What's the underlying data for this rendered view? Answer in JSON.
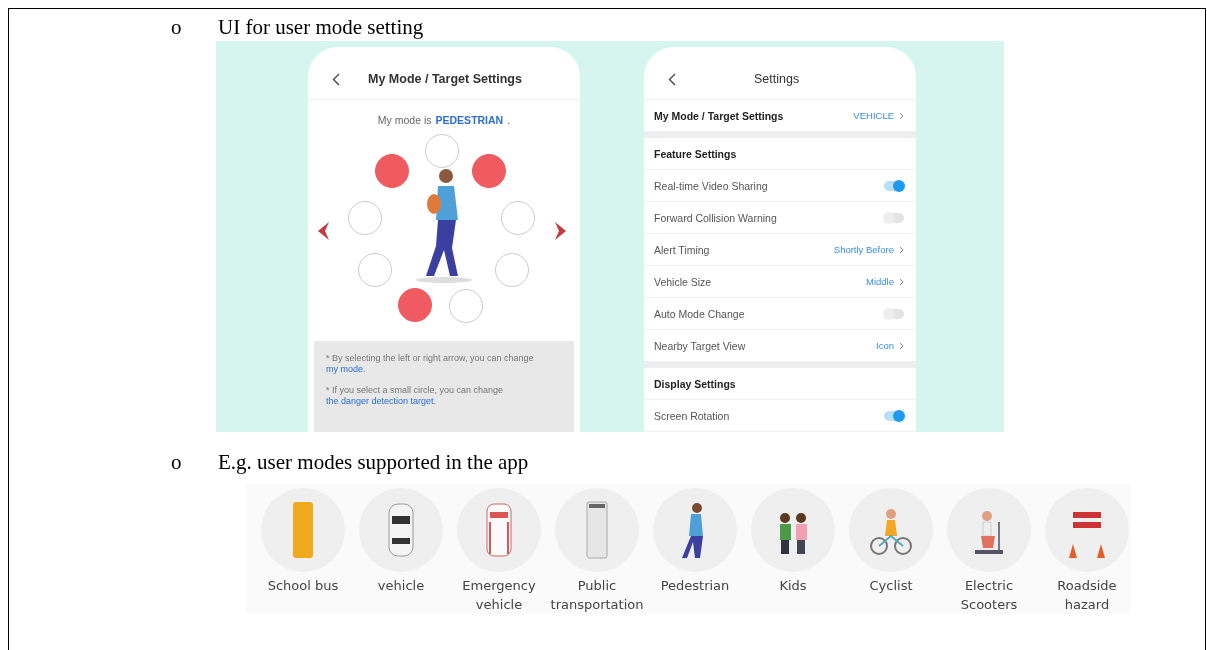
{
  "sections": [
    {
      "bullet": "o",
      "heading": "UI for user mode setting"
    },
    {
      "bullet": "o",
      "heading": "E.g. user modes supported in the app"
    }
  ],
  "mode_screen": {
    "title": "My Mode / Target Settings",
    "mode_prefix": "My mode is",
    "mode_value": "PEDESTRIAN",
    "mode_suffix": ".",
    "targets": [
      {
        "selected": false
      },
      {
        "selected": true
      },
      {
        "selected": true
      },
      {
        "selected": false
      },
      {
        "selected": false
      },
      {
        "selected": false
      },
      {
        "selected": false
      },
      {
        "selected": true
      },
      {
        "selected": false
      }
    ],
    "notes": [
      {
        "text": "* By selecting the left or right arrow, you can change ",
        "link": "my mode",
        "end": "."
      },
      {
        "text": "* If you select a small circle, you can change ",
        "link": "the danger detection target",
        "end": "."
      }
    ]
  },
  "settings_screen": {
    "title": "Settings",
    "rows": [
      {
        "kind": "main",
        "label": "My Mode / Target Settings",
        "value": "VEHICLE"
      },
      {
        "kind": "section",
        "label": "Feature Settings"
      },
      {
        "kind": "toggle",
        "label": "Real-time Video Sharing",
        "on": true
      },
      {
        "kind": "toggle",
        "label": "Forward Collision Warning",
        "on": false
      },
      {
        "kind": "nav",
        "label": "Alert Timing",
        "value": "Shortly Before"
      },
      {
        "kind": "nav",
        "label": "Vehicle Size",
        "value": "Middle"
      },
      {
        "kind": "toggle",
        "label": "Auto Mode Change",
        "on": false
      },
      {
        "kind": "nav",
        "label": "Nearby Target View",
        "value": "Icon"
      },
      {
        "kind": "section",
        "label": "Display Settings"
      },
      {
        "kind": "toggle",
        "label": "Screen Rotation",
        "on": true
      }
    ]
  },
  "modes": [
    {
      "label": "School bus"
    },
    {
      "label": "vehicle"
    },
    {
      "label": "Emergency vehicle"
    },
    {
      "label": "Public transportation"
    },
    {
      "label": "Pedestrian"
    },
    {
      "label": "Kids"
    },
    {
      "label": "Cyclist"
    },
    {
      "label": "Electric Scooters"
    },
    {
      "label": "Roadside hazard"
    }
  ]
}
